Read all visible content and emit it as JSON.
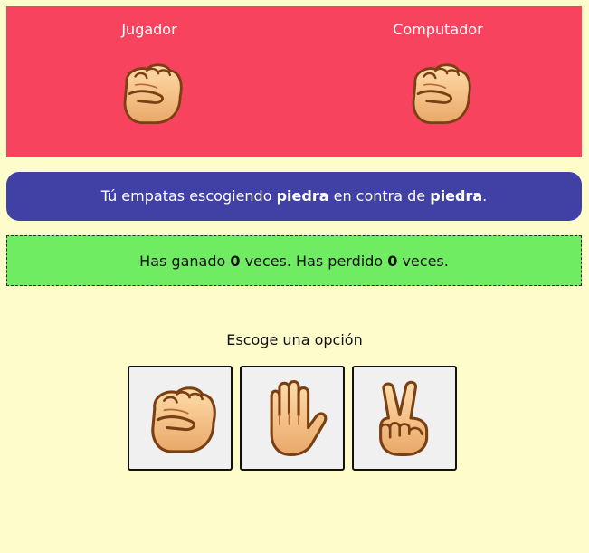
{
  "scoreboard": {
    "player_label": "Jugador",
    "computer_label": "Computador",
    "player_choice_icon": "rock-fist-icon",
    "computer_choice_icon": "rock-fist-icon",
    "background_color": "#f7435d"
  },
  "result": {
    "prefix": "Tú empatas escogiendo ",
    "player_choice": "piedra",
    "middle": " en contra de ",
    "computer_choice": "piedra",
    "suffix": ".",
    "background_color": "#4040a5"
  },
  "stats": {
    "won_prefix": "Has ganado ",
    "won_count": "0",
    "won_suffix": " veces. Has perdido ",
    "lost_count": "0",
    "lost_suffix": " veces.",
    "background_color": "#6fec62"
  },
  "options": {
    "prompt": "Escoge una opción",
    "items": [
      {
        "id": "piedra",
        "icon": "rock-fist-icon"
      },
      {
        "id": "papel",
        "icon": "paper-hand-icon"
      },
      {
        "id": "tijera",
        "icon": "scissors-victory-icon"
      }
    ]
  },
  "page": {
    "background_color": "#fffccb"
  }
}
